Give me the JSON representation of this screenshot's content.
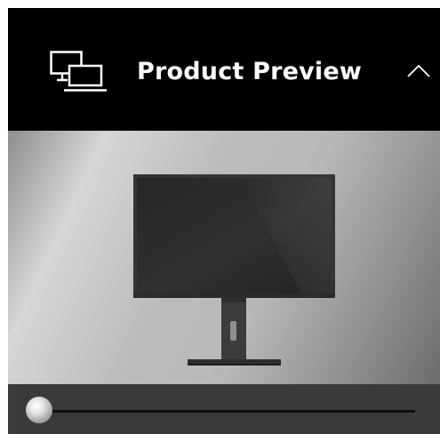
{
  "header": {
    "title": "Product Preview",
    "icon": "devices-icon",
    "collapse_icon": "chevron-up-icon"
  },
  "preview": {
    "product_image": "monitor"
  },
  "slider": {
    "value": 0
  },
  "colors": {
    "header_background": "#000000",
    "title_text": "#ffffff",
    "controls_background": "#3a3a3a",
    "track": "#0d0d0d"
  }
}
